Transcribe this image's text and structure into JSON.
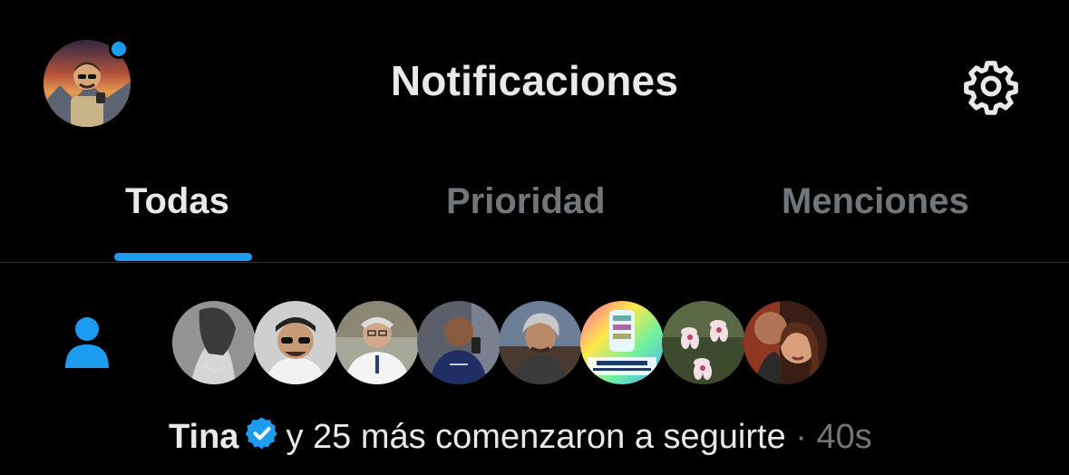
{
  "header": {
    "title": "Notificaciones",
    "avatar_icon": "user-avatar",
    "settings_icon": "gear-icon",
    "unread_dot_color": "#1d9bf0"
  },
  "tabs": [
    {
      "label": "Todas",
      "active": true
    },
    {
      "label": "Prioridad",
      "active": false
    },
    {
      "label": "Menciones",
      "active": false
    }
  ],
  "accent_color": "#1d9bf0",
  "notification": {
    "icon": "person-follow-icon",
    "avatar_count": 8,
    "name": "Tina",
    "verified_icon": "verified-badge-icon",
    "message": "y 25 más comenzaron a seguirte",
    "separator": "·",
    "time": "40s"
  }
}
